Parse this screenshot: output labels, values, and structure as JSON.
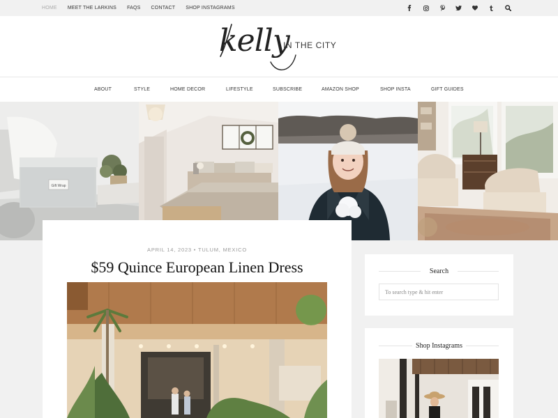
{
  "topnav": {
    "items": [
      {
        "label": "HOME",
        "active": true
      },
      {
        "label": "MEET THE LARKINS"
      },
      {
        "label": "FAQS"
      },
      {
        "label": "CONTACT"
      },
      {
        "label": "SHOP INSTAGRAMS"
      }
    ],
    "social_icons": [
      "facebook-icon",
      "instagram-icon",
      "pinterest-icon",
      "twitter-icon",
      "heart-icon",
      "tumblr-icon",
      "search-icon"
    ]
  },
  "header": {
    "logo_script": "kelly",
    "logo_tagline": "IN THE CITY"
  },
  "mainnav": {
    "items": [
      "ABOUT",
      "STYLE",
      "HOME DECOR",
      "LIFESTYLE",
      "SUBSCRIBE",
      "AMAZON SHOP",
      "SHOP INSTA",
      "GIFT GUIDES"
    ]
  },
  "strip": {
    "tiles": [
      {
        "name": "living-room-storage-box-photo",
        "label_on_box": "Gift Wrap"
      },
      {
        "name": "bedroom-photo"
      },
      {
        "name": "girl-in-snow-photo"
      },
      {
        "name": "sitting-room-chairs-photo"
      }
    ]
  },
  "post": {
    "meta": "APRIL 14, 2023 • TULUM, MEXICO",
    "title": "$59 Quince European Linen Dress"
  },
  "sidebar": {
    "search": {
      "title": "Search",
      "placeholder": "To search type & hit enter"
    },
    "instagram": {
      "title": "Shop Instagrams"
    }
  },
  "colors": {
    "page_bg": "#f1f1f1",
    "card_bg": "#ffffff",
    "muted_text": "#999999"
  }
}
